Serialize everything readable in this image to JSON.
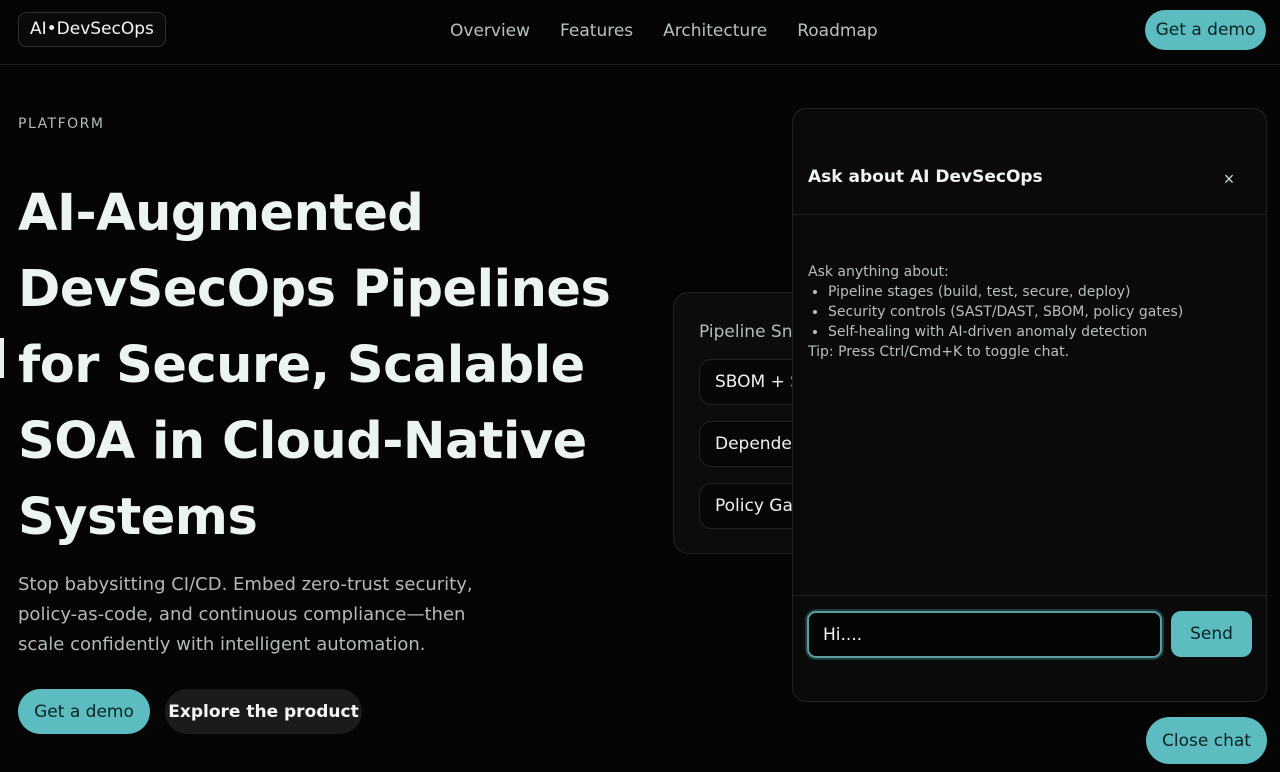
{
  "header": {
    "logo": "AI•DevSecOps",
    "nav": [
      "Overview",
      "Features",
      "Architecture",
      "Roadmap"
    ],
    "demo_label": "Get a demo"
  },
  "hero": {
    "eyebrow": "PLATFORM",
    "title": "AI-Augmented DevSecOps Pipelines for Secure, Scalable SOA in Cloud-Native Systems",
    "subtitle": "Stop babysitting CI/CD. Embed zero-trust security, policy-as-code, and continuous compliance—then scale confidently with intelligent automation.",
    "primary_label": "Get a demo",
    "secondary_label": "Explore the product"
  },
  "snapshot": {
    "title": "Pipeline Sna",
    "items": [
      "SBOM + S",
      "Depender",
      "Policy Gat"
    ]
  },
  "chat": {
    "title": "Ask about AI DevSecOps",
    "close_glyph": "×",
    "intro": "Ask anything about:",
    "bullets": [
      "Pipeline stages (build, test, secure, deploy)",
      "Security controls (SAST/DAST, SBOM, policy gates)",
      "Self-healing with AI-driven anomaly detection"
    ],
    "tip": "Tip: Press Ctrl/Cmd+K to toggle chat.",
    "input_value": "Hi....",
    "send_label": "Send"
  },
  "close_chat_label": "Close chat",
  "colors": {
    "accent": "#5cbcc0",
    "background": "#050505"
  }
}
